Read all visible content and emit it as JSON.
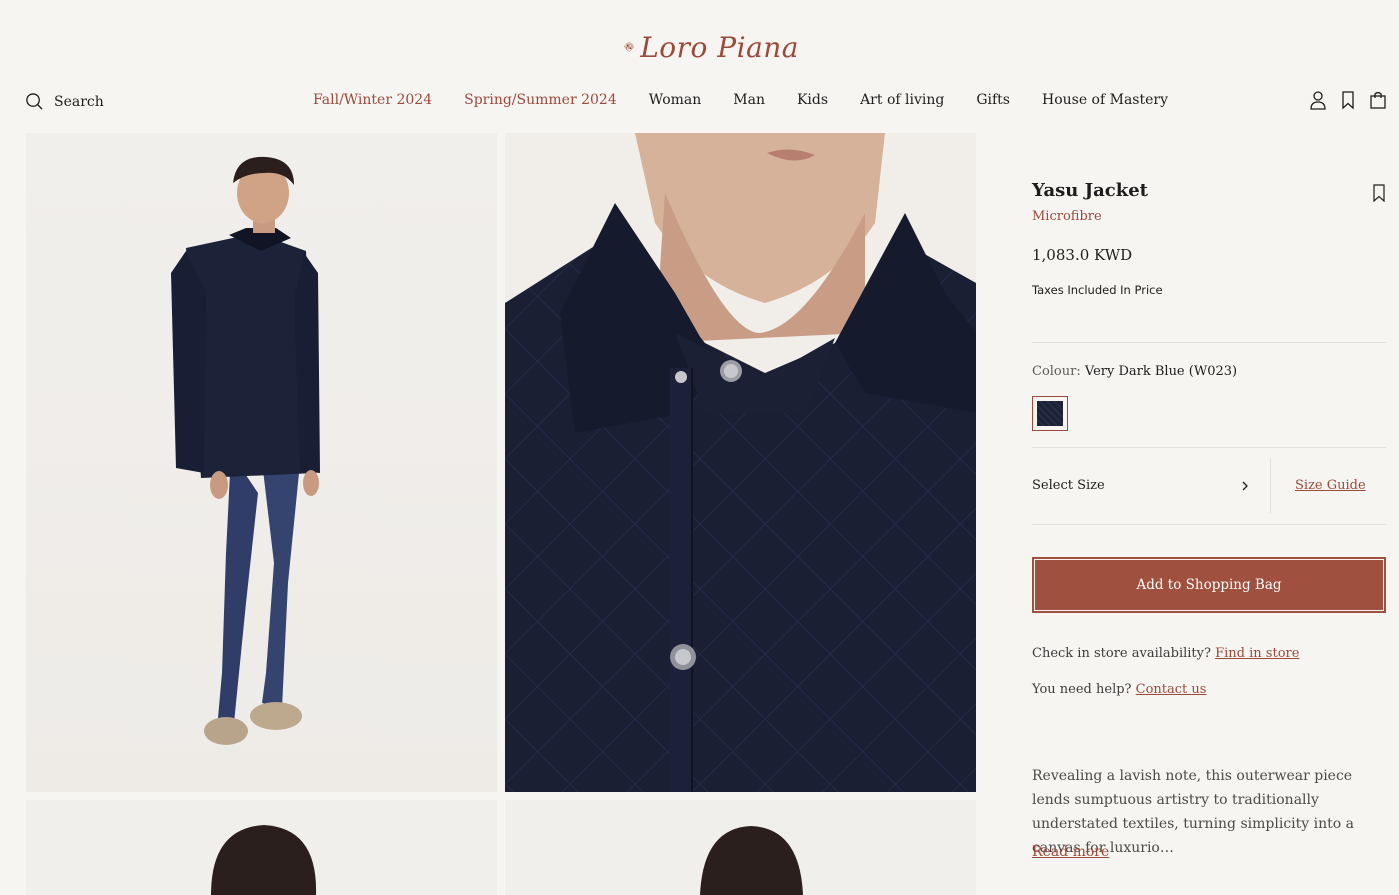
{
  "brand": {
    "name": "Loro Piana",
    "accent": "#9b4a3c"
  },
  "search": {
    "label": "Search"
  },
  "nav": {
    "items": [
      {
        "label": "Fall/Winter 2024",
        "accent": true
      },
      {
        "label": "Spring/Summer 2024",
        "accent": true
      },
      {
        "label": "Woman"
      },
      {
        "label": "Man"
      },
      {
        "label": "Kids"
      },
      {
        "label": "Art of living"
      },
      {
        "label": "Gifts"
      },
      {
        "label": "House of Mastery"
      }
    ]
  },
  "header_icons": [
    "account-icon",
    "wishlist-icon",
    "shopping-bag-icon"
  ],
  "product": {
    "title": "Yasu Jacket",
    "material": "Microfibre",
    "price": "1,083.0 KWD",
    "tax_note": "Taxes Included In Price",
    "colour_label": "Colour:",
    "colour_value": "Very Dark Blue (W023)",
    "select_size": "Select Size",
    "size_guide": "Size Guide",
    "add_to_bag": "Add to Shopping Bag",
    "store_prompt": "Check in store availability?",
    "store_link": "Find in store",
    "help_prompt": "You need help?",
    "help_link": "Contact us",
    "description": "Revealing a lavish note, this outerwear piece lends sumptuous artistry to traditionally understated textiles, turning simplicity into a canvas for luxurio…",
    "read_more": "Read more"
  }
}
